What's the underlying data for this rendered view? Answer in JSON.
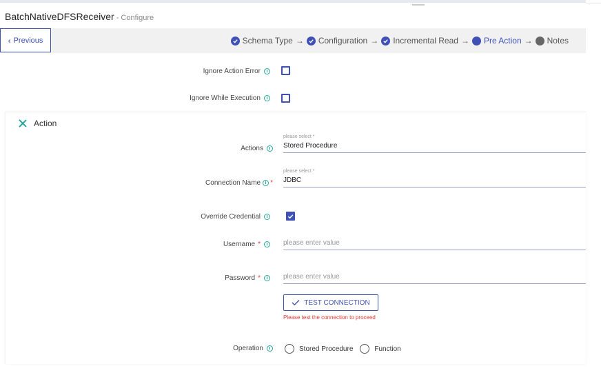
{
  "header": {
    "title": "BatchNativeDFSReceiver",
    "separator": "-",
    "subtitle": "Configure"
  },
  "stepbar": {
    "previous_label": "Previous",
    "steps": [
      {
        "label": "Schema Type",
        "state": "done"
      },
      {
        "label": "Configuration",
        "state": "done"
      },
      {
        "label": "Incremental Read",
        "state": "done"
      },
      {
        "label": "Pre Action",
        "state": "active"
      },
      {
        "label": "Notes",
        "state": "pending"
      }
    ],
    "arrow": "→"
  },
  "top_fields": {
    "ignore_action_error": {
      "label": "Ignore Action Error",
      "checked": false
    },
    "ignore_while_execution": {
      "label": "Ignore While Execution",
      "checked": false
    }
  },
  "action_panel": {
    "title": "Action",
    "actions": {
      "label": "Actions",
      "hint": "please select *",
      "value": "Stored Procedure"
    },
    "connection_name": {
      "label": "Connection Name",
      "required_mark": "*",
      "hint": "please select *",
      "value": "JDBC"
    },
    "override_credential": {
      "label": "Override Credential",
      "checked": true
    },
    "username": {
      "label": "Username",
      "required_mark": "*",
      "placeholder": "please enter value",
      "value": ""
    },
    "password": {
      "label": "Password",
      "required_mark": "*",
      "placeholder": "please enter value",
      "value": ""
    },
    "test_connection": {
      "label": "TEST CONNECTION",
      "warning": "Please test the connection to proceed"
    },
    "operation": {
      "label": "Operation",
      "options": [
        "Stored Procedure",
        "Function"
      ],
      "selected": null
    }
  },
  "colors": {
    "accent": "#3f51b5",
    "info": "#26a69a",
    "error": "#e53935"
  }
}
